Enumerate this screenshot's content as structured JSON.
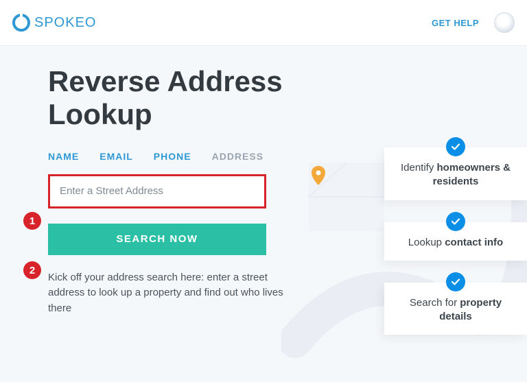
{
  "header": {
    "brand": "SPOKEO",
    "help": "GET HELP"
  },
  "page": {
    "title": "Reverse Address Lookup",
    "description": "Kick off your address search here: enter a street address to look up a property and find out who lives there"
  },
  "tabs": [
    {
      "label": "NAME",
      "active": true
    },
    {
      "label": "EMAIL",
      "active": true
    },
    {
      "label": "PHONE",
      "active": true
    },
    {
      "label": "ADDRESS",
      "active": false
    }
  ],
  "search": {
    "placeholder": "Enter a Street Address",
    "button": "SEARCH NOW"
  },
  "benefits": [
    {
      "prefix": "Identify ",
      "bold": "homeowners & residents",
      "suffix": ""
    },
    {
      "prefix": "Lookup ",
      "bold": "contact info",
      "suffix": ""
    },
    {
      "prefix": "Search for ",
      "bold": "property details",
      "suffix": ""
    }
  ],
  "annotations": {
    "1": "1",
    "2": "2"
  }
}
